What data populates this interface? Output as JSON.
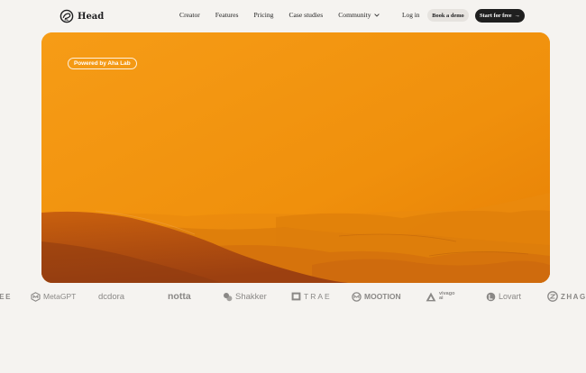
{
  "header": {
    "logo_text": "Head",
    "nav": [
      {
        "label": "Creator"
      },
      {
        "label": "Features"
      },
      {
        "label": "Pricing"
      },
      {
        "label": "Case studies"
      },
      {
        "label": "Community",
        "has_dropdown": true
      }
    ],
    "login_label": "Log in",
    "demo_label": "Book a demo",
    "start_label": "Start for free",
    "start_arrow": "→"
  },
  "hero": {
    "badge": "Powered by Aha Lab"
  },
  "logos": [
    {
      "name": "ZHAGEE",
      "text": "AEE"
    },
    {
      "name": "MetaGPT",
      "text": "MetaGPT"
    },
    {
      "name": "Dcdora",
      "text": "dcdora"
    },
    {
      "name": "notta",
      "text": "notta"
    },
    {
      "name": "Shakker",
      "text": "Shakker"
    },
    {
      "name": "TRAE",
      "text": "TRAE"
    },
    {
      "name": "MOOTION",
      "text": "MOOTION"
    },
    {
      "name": "vivago ai",
      "text": "vivago",
      "sub": "ai"
    },
    {
      "name": "Lovart",
      "text": "Lovart"
    },
    {
      "name": "ZHAGEE",
      "text": "ZHAGE"
    }
  ],
  "colors": {
    "background": "#f5f3f0",
    "hero_orange": "#f08f0c",
    "dune_dark": "#a84a10",
    "cta_dark": "#1f1f1f",
    "logo_gray": "#8a8886"
  }
}
